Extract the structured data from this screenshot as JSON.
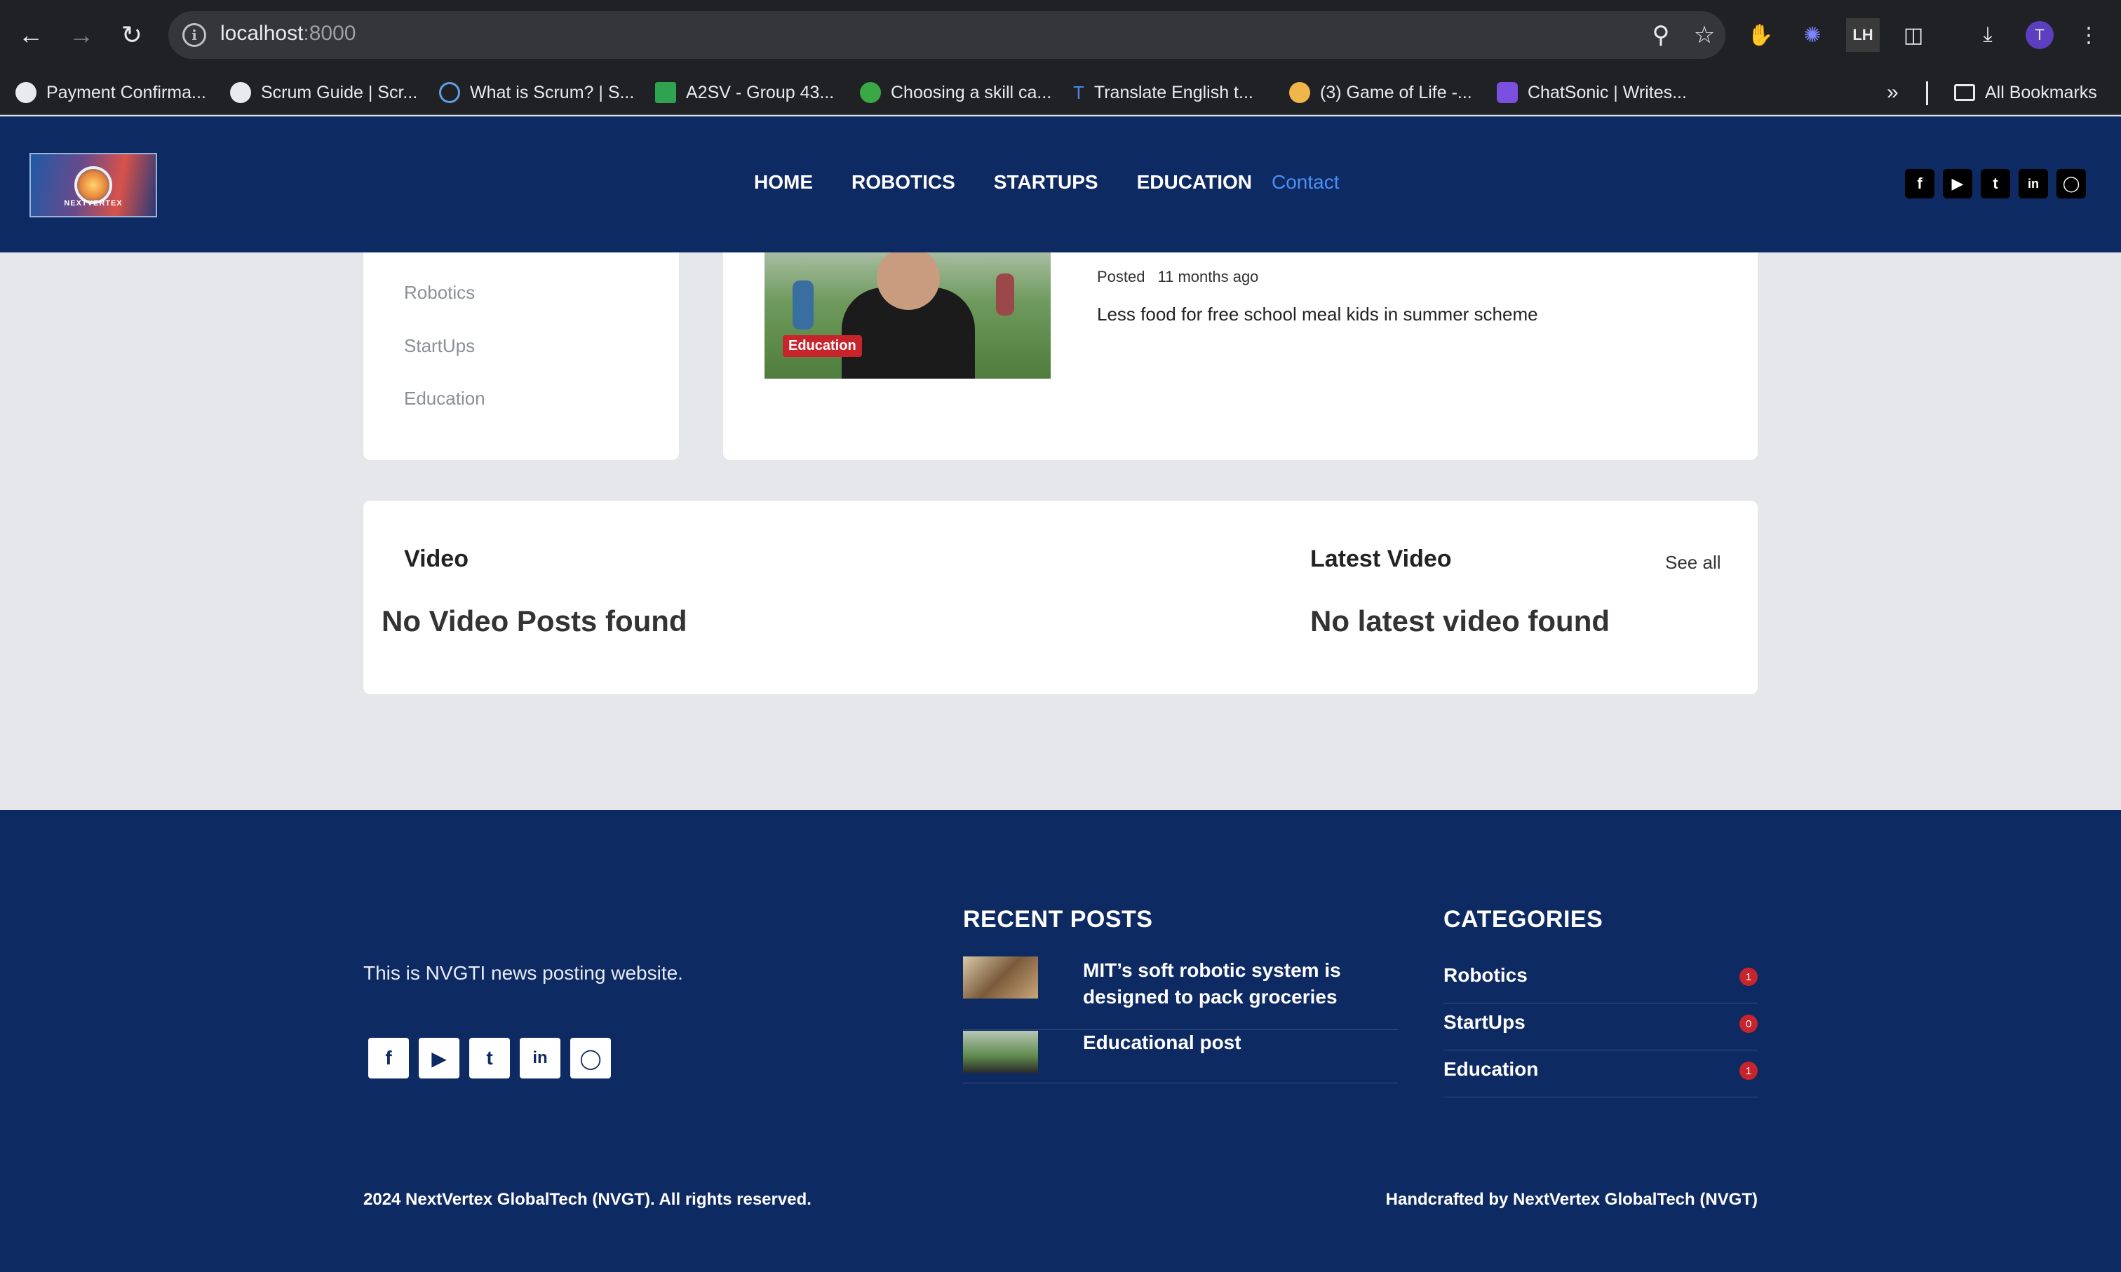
{
  "browser": {
    "url_host": "localhost",
    "url_port": ":8000",
    "bookmarks": [
      {
        "label": "Payment Confirma...",
        "color": "#e8eaed"
      },
      {
        "label": "Scrum Guide | Scr...",
        "color": "#e8eaed"
      },
      {
        "label": "What is Scrum? | S...",
        "color": "#5f9ee6"
      },
      {
        "label": "A2SV - Group 43...",
        "color": "#2fa34f"
      },
      {
        "label": "Choosing a skill ca...",
        "color": "#3aa845"
      },
      {
        "label": "Translate English t...",
        "color": "#4a86e8"
      },
      {
        "label": "(3) Game of Life -...",
        "color": "#f0b64b"
      },
      {
        "label": "ChatSonic | Writes...",
        "color": "#7b4fe0"
      }
    ],
    "all_bookmarks": "All Bookmarks",
    "profile_initial": "T"
  },
  "header": {
    "logo_text": "NEXTVERTEX",
    "nav": [
      "HOME",
      "ROBOTICS",
      "STARTUPS",
      "EDUCATION",
      "Contact"
    ]
  },
  "sidebar": {
    "categories": [
      "Robotics",
      "StartUps",
      "Education"
    ]
  },
  "post": {
    "badge": "Education",
    "posted_label": "Posted",
    "posted_ago": "11 months ago",
    "excerpt": "Less food for free school meal kids in summer scheme"
  },
  "video": {
    "title": "Video",
    "empty": "No Video Posts found",
    "latest_title": "Latest Video",
    "see_all": "See all",
    "latest_empty": "No latest video found"
  },
  "footer": {
    "description": "This is NVGTI news posting website.",
    "recent_title": "RECENT POSTS",
    "recent_posts": [
      "MIT’s soft robotic system is designed to pack groceries",
      "Educational post"
    ],
    "categories_title": "CATEGORIES",
    "categories": [
      {
        "name": "Robotics",
        "count": "1"
      },
      {
        "name": "StartUps",
        "count": "0"
      },
      {
        "name": "Education",
        "count": "1"
      }
    ],
    "copyright": "2024 NextVertex GlobalTech (NVGT). All rights reserved.",
    "credit": "Handcrafted by NextVertex GlobalTech (NVGT)"
  },
  "colors": {
    "navy": "#0e2a63",
    "accent_link": "#4a8ff0",
    "badge_red": "#c8242b",
    "page_bg": "#e6e7ea"
  }
}
